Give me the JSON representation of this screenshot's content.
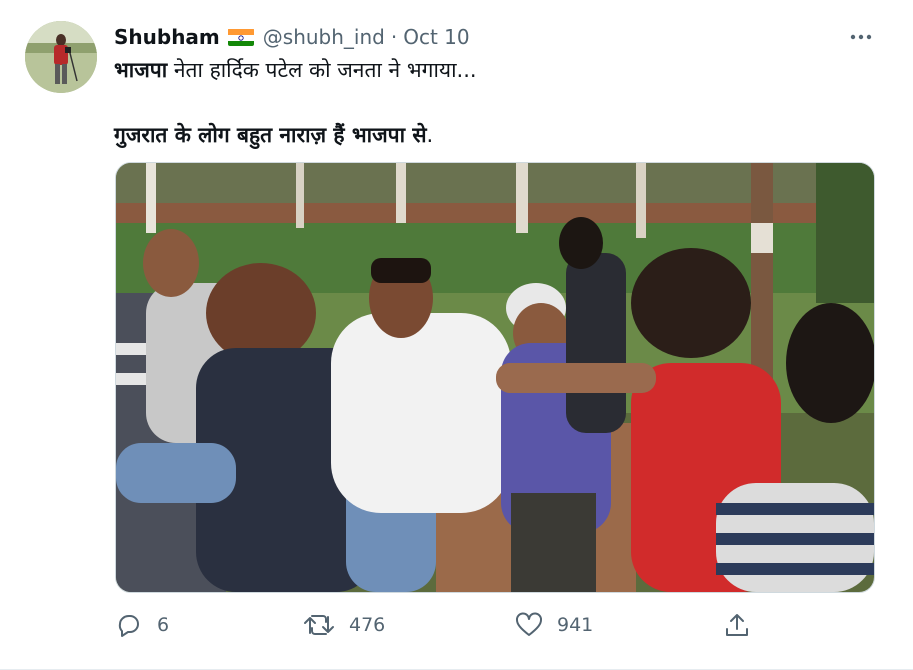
{
  "tweet": {
    "author_name": "Shubham",
    "author_handle": "@shubh_ind",
    "separator": "·",
    "timestamp": "Oct 10",
    "text_line1_bold": "भाजपा",
    "text_line1_rest": " नेता हार्दिक पटेल को जनता ने भगाया...",
    "text_line2_bold": "गुजरात के लोग बहुत नाराज़ हैं भाजपा से",
    "text_line2_rest": ".",
    "flag_icon": "india-flag-icon",
    "more_icon": "more-options-icon"
  },
  "actions": {
    "reply_count": "6",
    "retweet_count": "476",
    "like_count": "941"
  },
  "colors": {
    "text_primary": "#0f1419",
    "text_secondary": "#536471",
    "border": "#cfd9de"
  }
}
